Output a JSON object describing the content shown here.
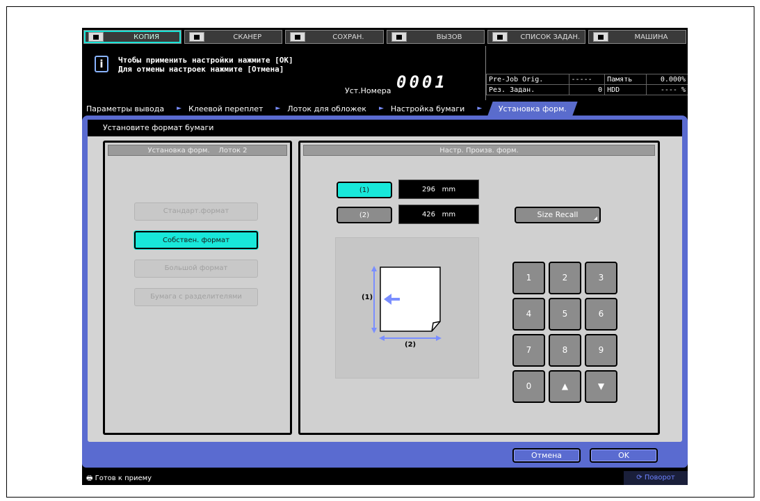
{
  "top_tabs": [
    {
      "label": "КОПИЯ",
      "icon": "copy-icon",
      "active": true
    },
    {
      "label": "СКАНЕР",
      "icon": "scanner-icon",
      "active": false
    },
    {
      "label": "СОХРАН.",
      "icon": "save-icon",
      "active": false
    },
    {
      "label": "ВЫЗОВ",
      "icon": "recall-icon",
      "active": false
    },
    {
      "label": "СПИСОК ЗАДАН.",
      "icon": "job-list-icon",
      "active": false
    },
    {
      "label": "МАШИНА",
      "icon": "machine-icon",
      "active": false
    }
  ],
  "message": {
    "line1": "Чтобы применить настройки нажмите [OK]",
    "line2": "Для отмены настроек нажмите [Отмена]",
    "info_icon": "i"
  },
  "set_number": {
    "label": "Уст.Номера",
    "value": "0001"
  },
  "status_table": {
    "prejob_label": "Pre-Job Orig.",
    "prejob_value": "-----",
    "memory_label": "Память",
    "memory_value": "0.000%",
    "reserve_label": "Рез. Задан.",
    "reserve_value": "0",
    "hdd_label": "HDD",
    "hdd_value": "---- %"
  },
  "breadcrumb": [
    "Параметры вывода",
    "Клеевой переплет",
    "Лоток для обложек",
    "Настройка бумаги",
    "Установка форм."
  ],
  "header_text": "Установите формат бумаги",
  "left_panel": {
    "title": "Установка форм.    Лоток 2",
    "buttons": [
      {
        "label": "Стандарт.формат",
        "state": "disabled"
      },
      {
        "label": "Собствен. формат",
        "state": "selected"
      },
      {
        "label": "Большой формат",
        "state": "disabled"
      },
      {
        "label": "Бумага с разделителями",
        "state": "disabled"
      }
    ]
  },
  "right_panel": {
    "title": "Настр. Произв. форм.",
    "dim1_button": "(1)",
    "dim1_value": "296",
    "dim1_unit": "mm",
    "dim2_button": "(2)",
    "dim2_value": "426",
    "dim2_unit": "mm",
    "size_recall": "Size Recall",
    "diagram_label1": "(1)",
    "diagram_label2": "(2)",
    "keypad": [
      "1",
      "2",
      "3",
      "4",
      "5",
      "6",
      "7",
      "8",
      "9",
      "0",
      "▲",
      "▼"
    ]
  },
  "footer": {
    "cancel": "Отмена",
    "ok": "OK"
  },
  "status_bar": {
    "left": "Готов к приему",
    "right": "Поворот"
  },
  "colors": {
    "accent": "#18e8da",
    "panel_blue": "#5a6bd0",
    "arrow_blue": "#7a8eff"
  }
}
